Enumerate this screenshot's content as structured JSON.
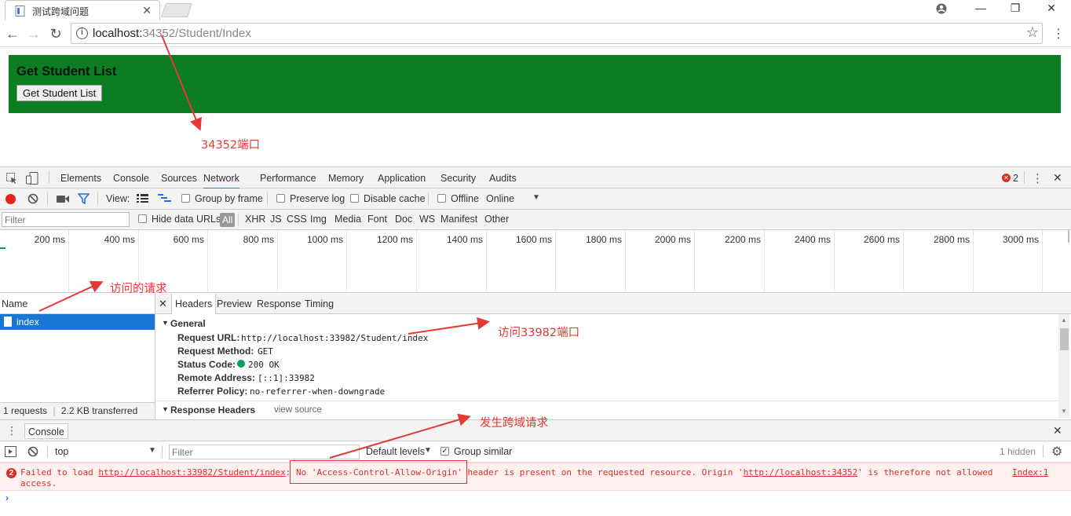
{
  "browser": {
    "tab_title": "测试跨域问题",
    "url_host": "localhost:",
    "url_rest": "34352/Student/Index"
  },
  "page": {
    "heading": "Get Student List",
    "button_label": "Get Student List",
    "banner_color": "#0b7d22"
  },
  "devtools": {
    "tabs": [
      "Elements",
      "Console",
      "Sources",
      "Network",
      "Performance",
      "Memory",
      "Application",
      "Security",
      "Audits"
    ],
    "active_tab": "Network",
    "error_count": "2",
    "toolbar": {
      "view_label": "View:",
      "group_by_frame": "Group by frame",
      "preserve_log": "Preserve log",
      "disable_cache": "Disable cache",
      "offline": "Offline",
      "throttle": "Online"
    },
    "filter": {
      "placeholder": "Filter",
      "hide_data_urls": "Hide data URLs",
      "types": [
        "All",
        "XHR",
        "JS",
        "CSS",
        "Img",
        "Media",
        "Font",
        "Doc",
        "WS",
        "Manifest",
        "Other"
      ]
    },
    "timeline_ticks": [
      "200 ms",
      "400 ms",
      "600 ms",
      "800 ms",
      "1000 ms",
      "1200 ms",
      "1400 ms",
      "1600 ms",
      "1800 ms",
      "2000 ms",
      "2200 ms",
      "2400 ms",
      "2600 ms",
      "2800 ms",
      "3000 ms"
    ],
    "requests": {
      "name_header": "Name",
      "rows": [
        "index"
      ],
      "summary_requests": "1 requests",
      "summary_transferred": "2.2 KB transferred"
    },
    "detail": {
      "tabs": [
        "Headers",
        "Preview",
        "Response",
        "Timing"
      ],
      "general_title": "General",
      "fields": [
        {
          "key": "Request URL:",
          "value": "http://localhost:33982/Student/index"
        },
        {
          "key": "Request Method:",
          "value": "GET"
        },
        {
          "key": "Status Code:",
          "value": "200 OK"
        },
        {
          "key": "Remote Address:",
          "value": "[::1]:33982"
        },
        {
          "key": "Referrer Policy:",
          "value": "no-referrer-when-downgrade"
        }
      ],
      "response_headers_title": "Response Headers",
      "view_source": "view source"
    },
    "console": {
      "title": "Console",
      "context": "top",
      "filter_placeholder": "Filter",
      "levels": "Default levels",
      "group_similar": "Group similar",
      "hidden": "1 hidden",
      "error": {
        "count": "2",
        "p1": "Failed to load ",
        "url1": "http://localhost:33982/Student/index",
        "p2": ": ",
        "cors": "No 'Access-Control-Allow-Origin'",
        "p3": " header is present on the requested resource. Origin '",
        "url2": "http://localhost:34352",
        "p4": "' is therefore not allowed access.",
        "source": "Index:1"
      }
    }
  },
  "annotations": {
    "port_label": "34352端口",
    "request_label": "访问的请求",
    "target_label": "访问33982端口",
    "cors_label": "发生跨域请求",
    "color": "#e53935"
  }
}
